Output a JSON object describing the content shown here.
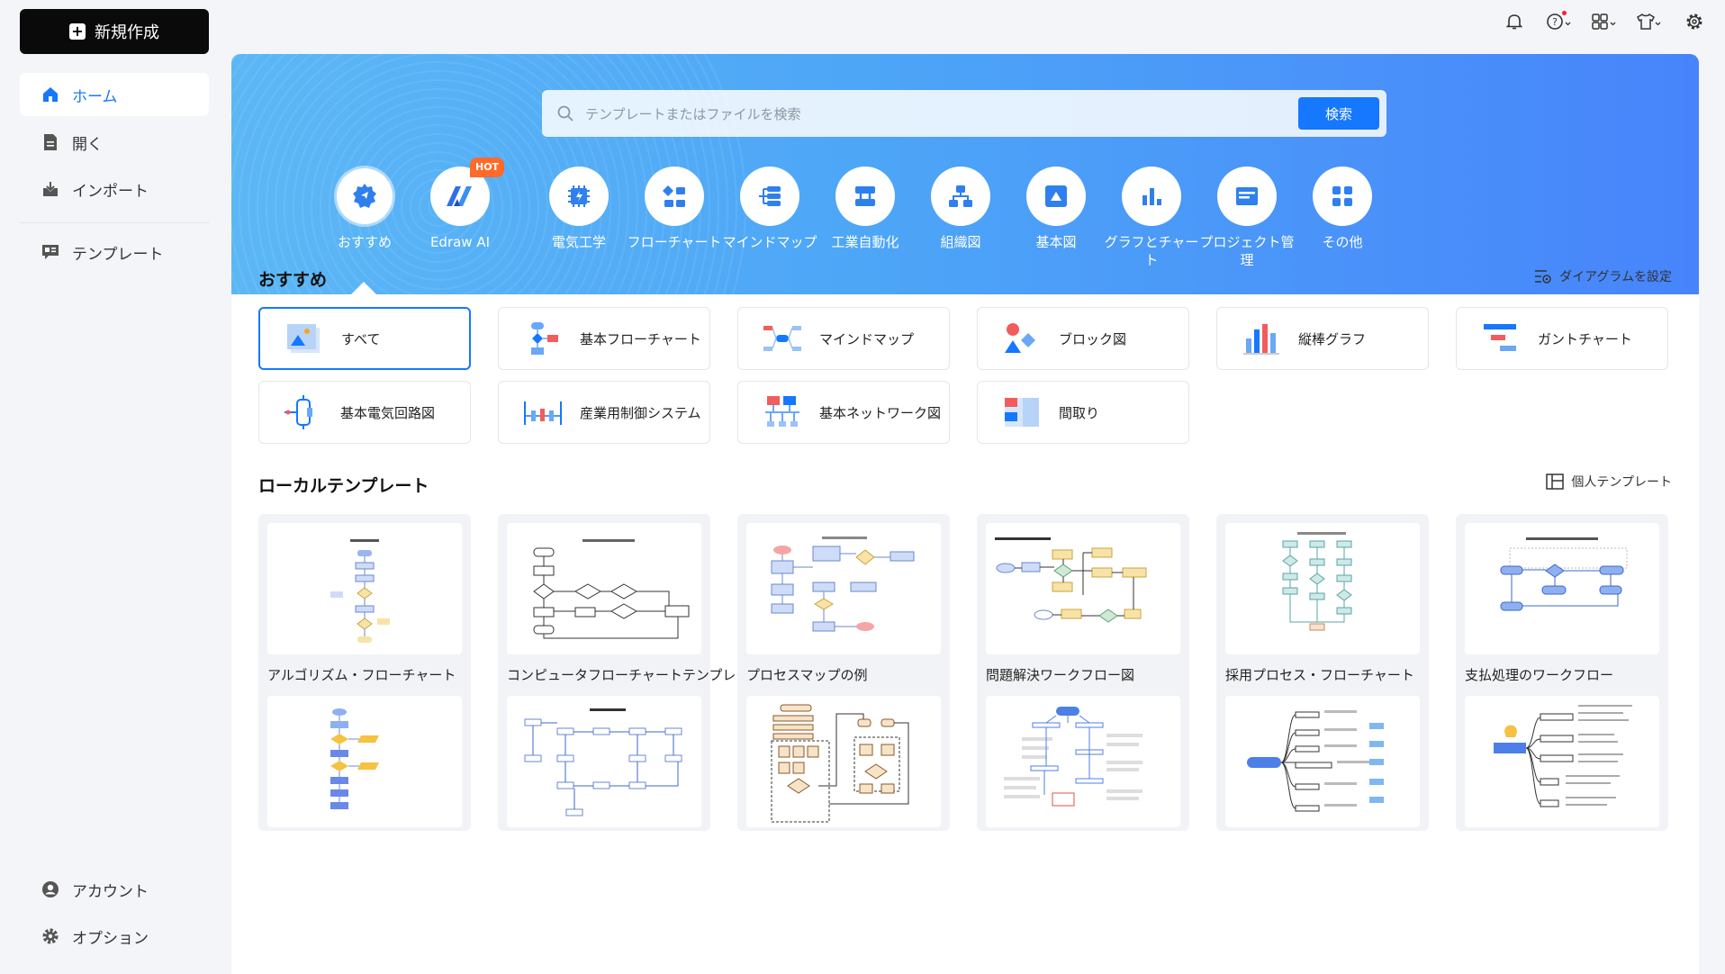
{
  "sidebar": {
    "new_label": "新規作成",
    "items": [
      {
        "label": "ホーム"
      },
      {
        "label": "開く"
      },
      {
        "label": "インポート"
      },
      {
        "label": "テンプレート"
      }
    ],
    "bottom": [
      {
        "label": "アカウント"
      },
      {
        "label": "オプション"
      }
    ]
  },
  "search": {
    "placeholder": "テンプレートまたはファイルを検索",
    "button": "検索"
  },
  "hot_badge": "HOT",
  "categories": [
    {
      "label": "おすすめ",
      "icon": "recommend-icon"
    },
    {
      "label": "Edraw AI",
      "icon": "edraw-ai-icon"
    },
    {
      "label": "電気工学",
      "icon": "electrical-icon"
    },
    {
      "label": "フローチャート",
      "icon": "flowchart-icon"
    },
    {
      "label": "マインドマップ",
      "icon": "mindmap-icon"
    },
    {
      "label": "工業自動化",
      "icon": "automation-icon"
    },
    {
      "label": "組織図",
      "icon": "orgchart-icon"
    },
    {
      "label": "基本図",
      "icon": "basic-icon"
    },
    {
      "label": "グラフとチャート",
      "icon": "chart-icon"
    },
    {
      "label": "プロジェクト管理",
      "icon": "project-icon"
    },
    {
      "label": "その他",
      "icon": "more-icon"
    }
  ],
  "recommended": {
    "title": "おすすめ",
    "link": "ダイアグラムを設定",
    "types": [
      {
        "label": "すべて"
      },
      {
        "label": "基本フローチャート"
      },
      {
        "label": "マインドマップ"
      },
      {
        "label": "ブロック図"
      },
      {
        "label": "縦棒グラフ"
      },
      {
        "label": "ガントチャート"
      },
      {
        "label": "基本電気回路図"
      },
      {
        "label": "産業用制御システム"
      },
      {
        "label": "基本ネットワーク図"
      },
      {
        "label": "間取り"
      }
    ]
  },
  "local": {
    "title": "ローカルテンプレート",
    "link": "個人テンプレート",
    "cards": [
      {
        "caption": "アルゴリズム・フローチャート"
      },
      {
        "caption": "コンピュータフローチャートテンプレート"
      },
      {
        "caption": "プロセスマップの例"
      },
      {
        "caption": "問題解決ワークフロー図"
      },
      {
        "caption": "採用プロセス・フローチャート"
      },
      {
        "caption": "支払処理のワークフロー"
      }
    ]
  },
  "colors": {
    "accent": "#1677ff",
    "hot": "#ff6a2a"
  }
}
